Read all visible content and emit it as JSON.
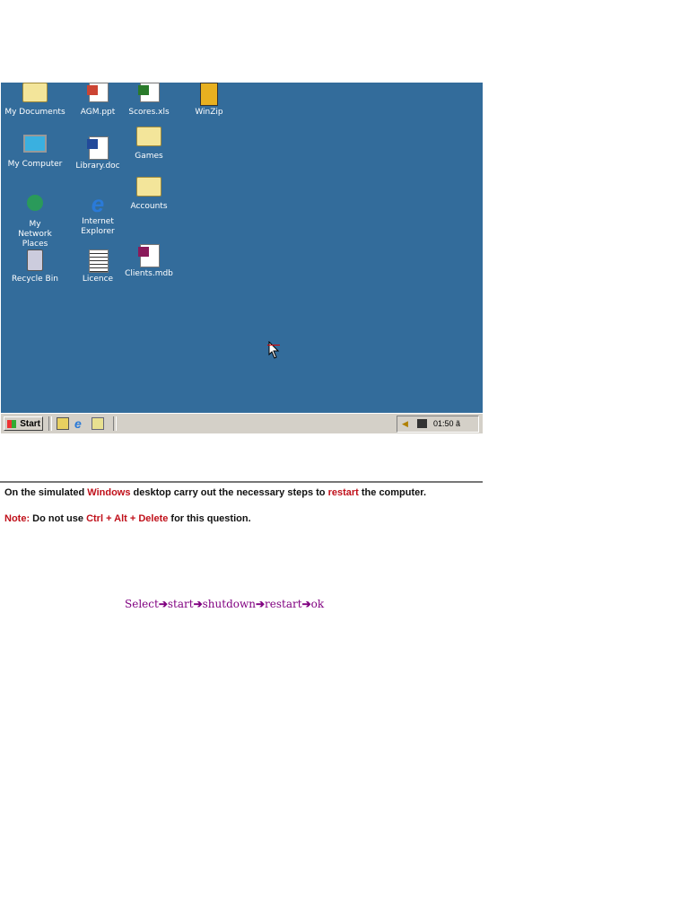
{
  "desktop": {
    "icons": [
      {
        "label": "My Documents",
        "icon": "my-documents-icon"
      },
      {
        "label": "AGM.ppt",
        "icon": "powerpoint-file-icon"
      },
      {
        "label": "Scores.xls",
        "icon": "excel-file-icon"
      },
      {
        "label": "WinZip",
        "icon": "winzip-icon"
      },
      {
        "label": "My Computer",
        "icon": "my-computer-icon"
      },
      {
        "label": "Library.doc",
        "icon": "word-file-icon"
      },
      {
        "label": "Games",
        "icon": "folder-icon"
      },
      {
        "label": "Accounts",
        "icon": "folder-icon"
      },
      {
        "label": "My Network Places",
        "icon": "network-icon"
      },
      {
        "label": "Internet Explorer",
        "icon": "internet-explorer-icon"
      },
      {
        "label": "Recycle Bin",
        "icon": "recycle-bin-icon"
      },
      {
        "label": "Licence",
        "icon": "text-file-icon"
      },
      {
        "label": "Clients.mdb",
        "icon": "access-file-icon"
      }
    ]
  },
  "taskbar": {
    "start": "Start",
    "clock": "01:50 ã"
  },
  "question": {
    "p1a": "On the simulated ",
    "p1b": "Windows",
    "p1c": " desktop carry out the necessary steps to ",
    "p1d": "restart",
    "p1e": " the computer.",
    "p2a": "Note:",
    "p2b": " Do not use ",
    "p2c": "Ctrl + Alt + Delete",
    "p2d": " for this question."
  },
  "answer": {
    "steps": [
      "Select",
      "start",
      "shutdown",
      "restart",
      "ok"
    ],
    "arrow": "➔"
  },
  "colors": {
    "desktop": "#336c9b",
    "highlight": "#c0101a",
    "answer": "#800080"
  }
}
